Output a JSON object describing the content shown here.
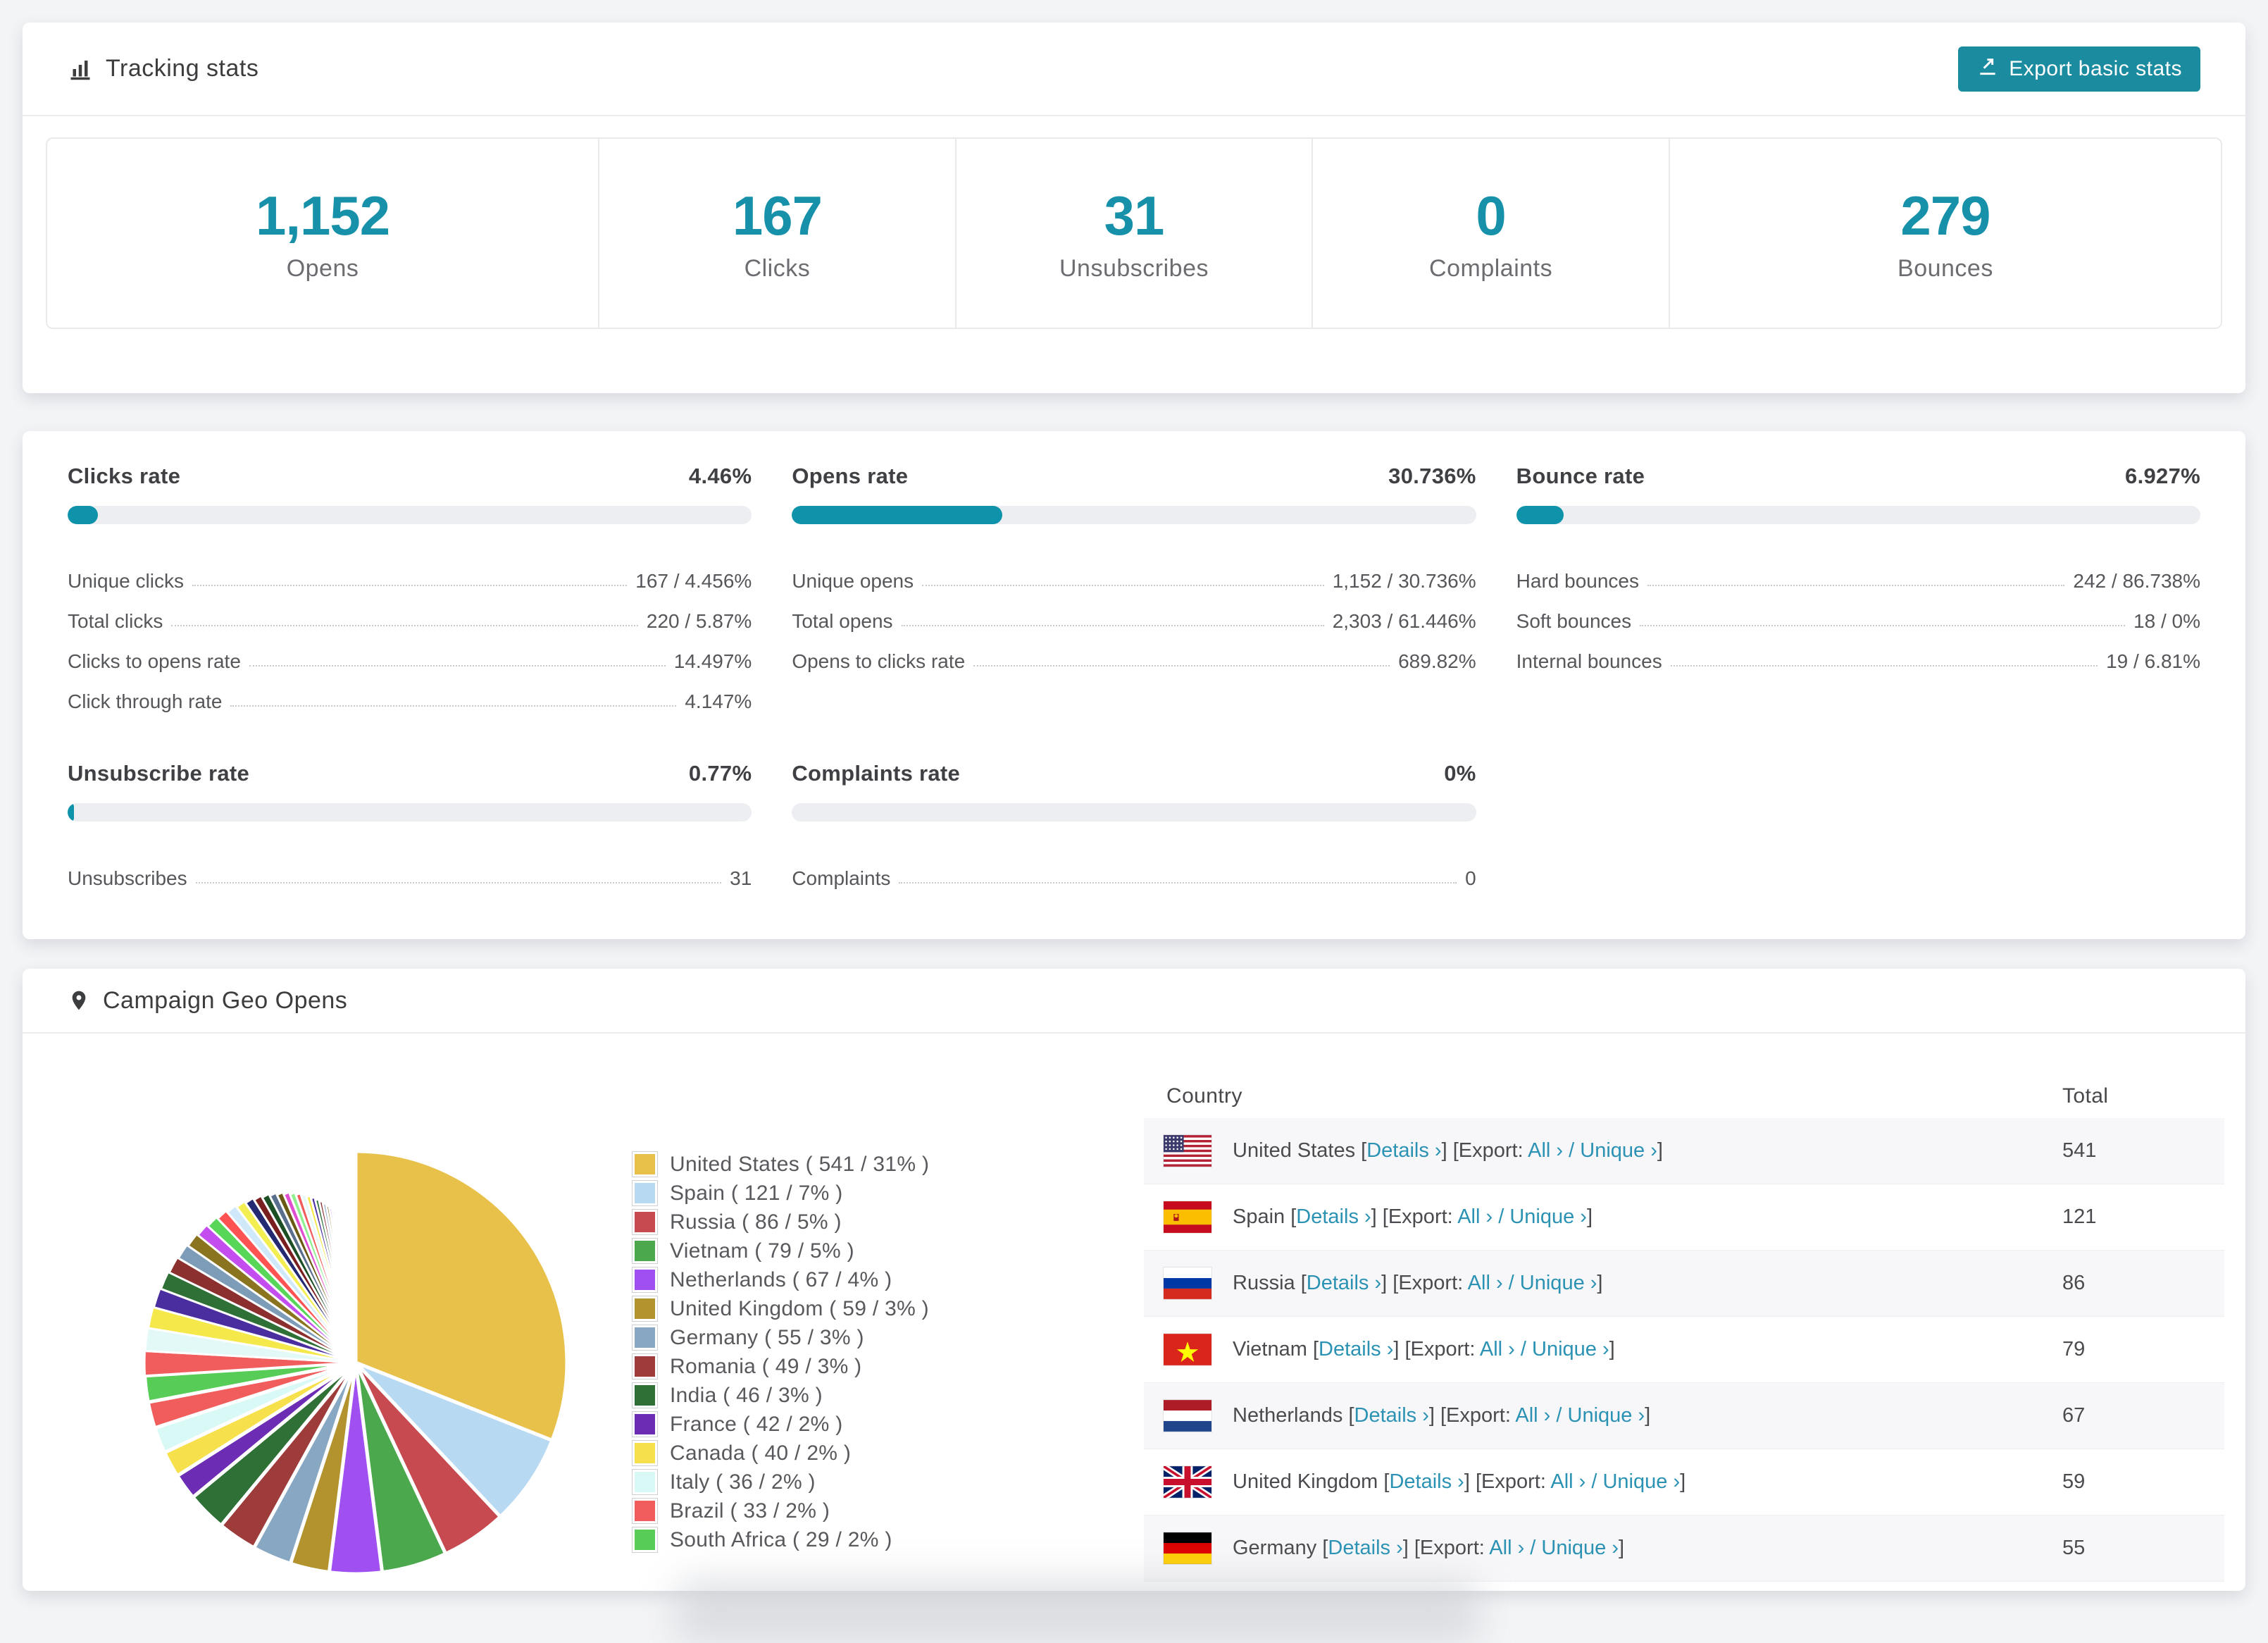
{
  "colors": {
    "accent": "#1791a9",
    "bar_fill": "#0f93ab",
    "button_bg": "#1b8b9f",
    "link": "#2b92b4"
  },
  "tracking_card": {
    "title": "Tracking stats",
    "export_button_label": "Export basic stats",
    "stats": [
      {
        "value": "1,152",
        "label": "Opens"
      },
      {
        "value": "167",
        "label": "Clicks"
      },
      {
        "value": "31",
        "label": "Unsubscribes"
      },
      {
        "value": "0",
        "label": "Complaints"
      },
      {
        "value": "279",
        "label": "Bounces"
      }
    ]
  },
  "rates_card": {
    "sections": [
      {
        "title": "Clicks rate",
        "value": "4.46%",
        "pct": 4.46,
        "rows": [
          [
            "Unique clicks",
            "167 / 4.456%"
          ],
          [
            "Total clicks",
            "220 / 5.87%"
          ],
          [
            "Clicks to opens rate",
            "14.497%"
          ],
          [
            "Click through rate",
            "4.147%"
          ]
        ]
      },
      {
        "title": "Opens rate",
        "value": "30.736%",
        "pct": 30.736,
        "rows": [
          [
            "Unique opens",
            "1,152 / 30.736%"
          ],
          [
            "Total opens",
            "2,303 / 61.446%"
          ],
          [
            "Opens to clicks rate",
            "689.82%"
          ]
        ]
      },
      {
        "title": "Bounce rate",
        "value": "6.927%",
        "pct": 6.927,
        "rows": [
          [
            "Hard bounces",
            "242 / 86.738%"
          ],
          [
            "Soft bounces",
            "18 / 0%"
          ],
          [
            "Internal bounces",
            "19 / 6.81%"
          ]
        ]
      },
      {
        "title": "Unsubscribe rate",
        "value": "0.77%",
        "pct": 0.77,
        "rows": [
          [
            "Unsubscribes",
            "31"
          ]
        ]
      },
      {
        "title": "Complaints rate",
        "value": "0%",
        "pct": 0,
        "rows": [
          [
            "Complaints",
            "0"
          ]
        ]
      }
    ]
  },
  "geo_card": {
    "title": "Campaign Geo Opens",
    "table": {
      "headers": [
        "Country",
        "Total"
      ],
      "links": {
        "details": "Details ›",
        "export_prefix": "[Export:",
        "all": "All ›",
        "slash": "/",
        "unique": "Unique ›",
        "open_bracket": "[",
        "close_bracket": "]"
      },
      "rows": [
        {
          "flag": "us",
          "country": "United States",
          "total": "541"
        },
        {
          "flag": "es",
          "country": "Spain",
          "total": "121"
        },
        {
          "flag": "ru",
          "country": "Russia",
          "total": "86"
        },
        {
          "flag": "vn",
          "country": "Vietnam",
          "total": "79"
        },
        {
          "flag": "nl",
          "country": "Netherlands",
          "total": "67"
        },
        {
          "flag": "gb",
          "country": "United Kingdom",
          "total": "59"
        },
        {
          "flag": "de",
          "country": "Germany",
          "total": "55"
        }
      ]
    }
  },
  "chart_data": {
    "type": "pie",
    "title": "Campaign Geo Opens",
    "legend_position": "right",
    "start_angle_deg": 0,
    "series": [
      {
        "label": "United States",
        "value": 541,
        "pct": 31,
        "color": "#e8c14a"
      },
      {
        "label": "Spain",
        "value": 121,
        "pct": 7,
        "color": "#b7d9f2"
      },
      {
        "label": "Russia",
        "value": 86,
        "pct": 5,
        "color": "#c64a50"
      },
      {
        "label": "Vietnam",
        "value": 79,
        "pct": 5,
        "color": "#4ca84c"
      },
      {
        "label": "Netherlands",
        "value": 67,
        "pct": 4,
        "color": "#a04ff0"
      },
      {
        "label": "United Kingdom",
        "value": 59,
        "pct": 3,
        "color": "#b3932d"
      },
      {
        "label": "Germany",
        "value": 55,
        "pct": 3,
        "color": "#87a7c3"
      },
      {
        "label": "Romania",
        "value": 49,
        "pct": 3,
        "color": "#9e3b3b"
      },
      {
        "label": "India",
        "value": 46,
        "pct": 3,
        "color": "#2e7036"
      },
      {
        "label": "France",
        "value": 42,
        "pct": 2,
        "color": "#6c2cb4"
      },
      {
        "label": "Canada",
        "value": 40,
        "pct": 2,
        "color": "#f6e04b"
      },
      {
        "label": "Italy",
        "value": 36,
        "pct": 2,
        "color": "#d9f9f6"
      },
      {
        "label": "Brazil",
        "value": 33,
        "pct": 2,
        "color": "#f15d5d"
      },
      {
        "label": "South Africa",
        "value": 29,
        "pct": 2,
        "color": "#57cd57"
      }
    ],
    "others": {
      "note": "many small unlabeled countries as thin slices",
      "total_pct": 26,
      "count": 48,
      "decay": 0.93,
      "palette": [
        "#f15d5d",
        "#e3f9f7",
        "#f5e84b",
        "#4a2d9e",
        "#2e7036",
        "#8b2f2f",
        "#7d9cb8",
        "#8a7420",
        "#c44df0",
        "#57d657",
        "#ff5252",
        "#cfe9fb",
        "#f3ef52",
        "#232a72",
        "#7a1f1f",
        "#1c4f24",
        "#5a6f8e",
        "#6b5a14",
        "#e04dd0",
        "#8ef08e"
      ]
    }
  }
}
